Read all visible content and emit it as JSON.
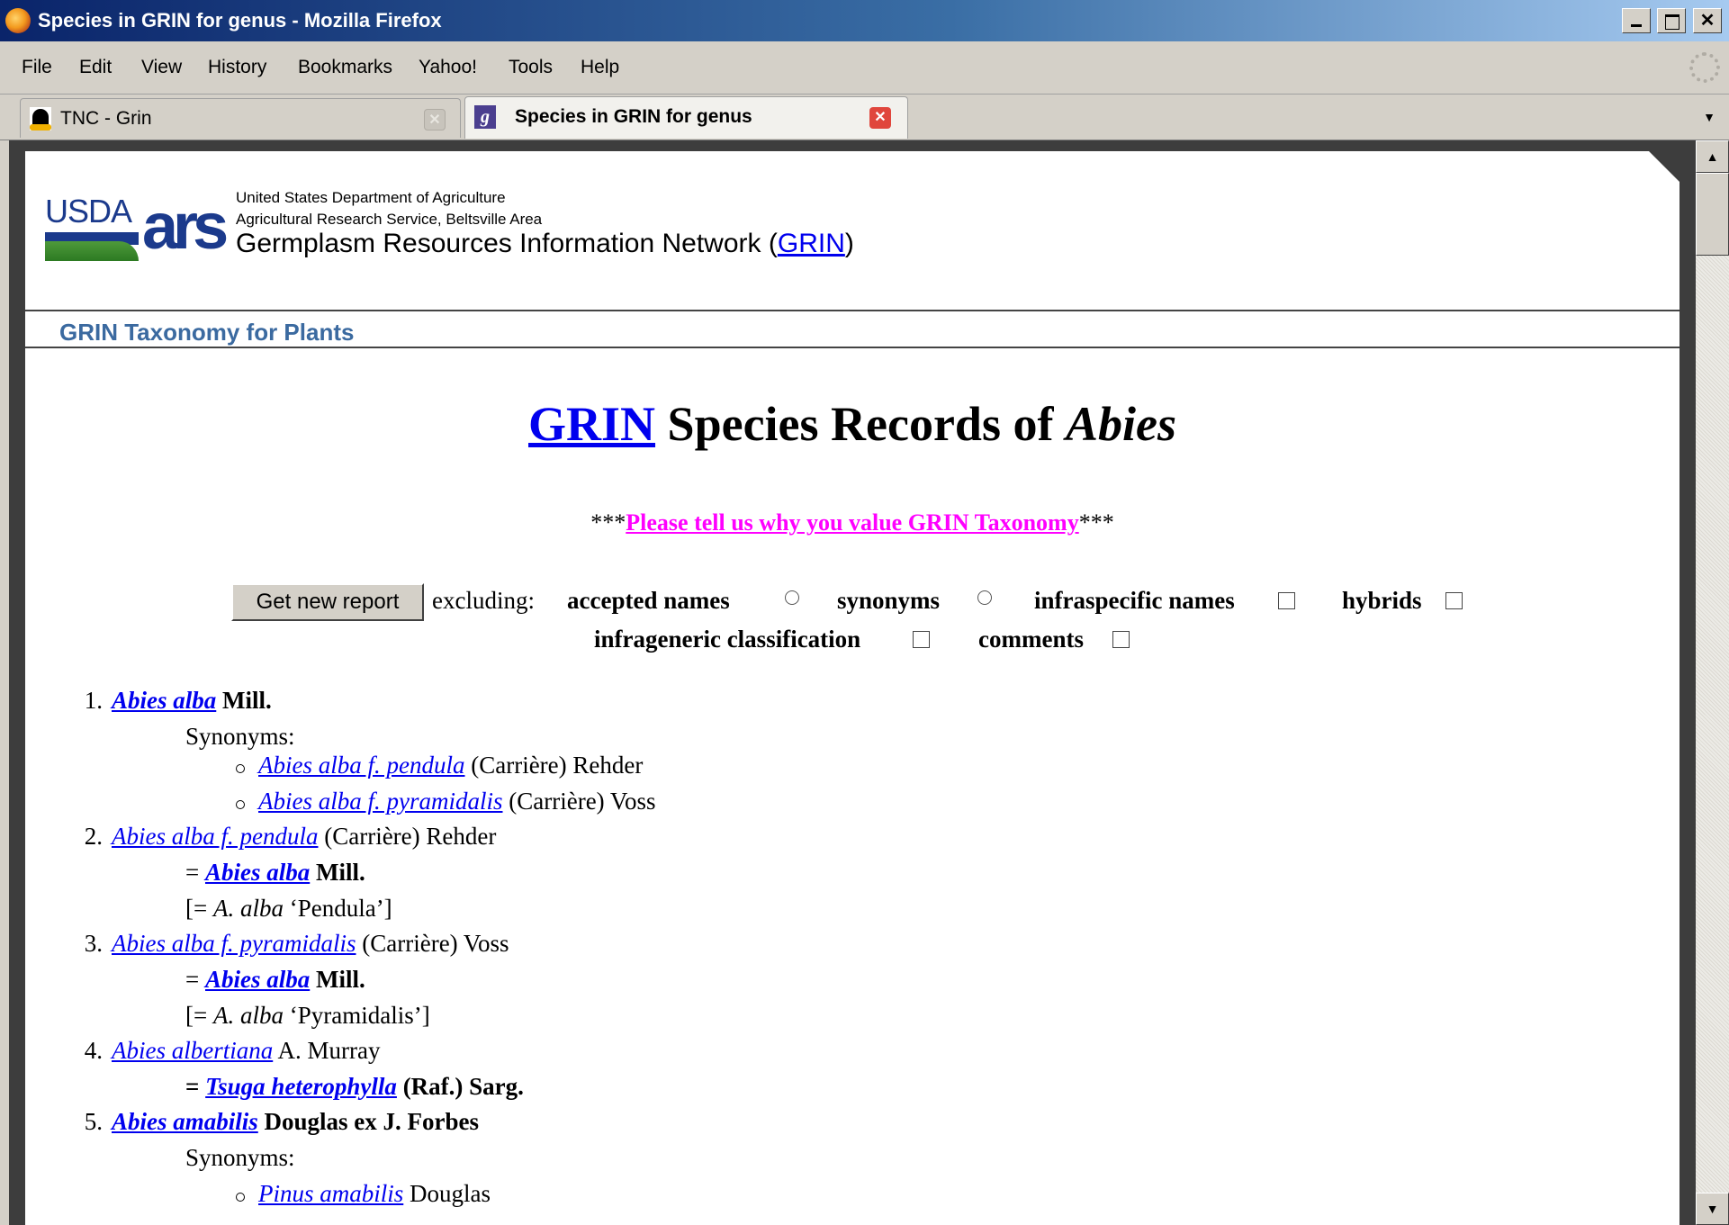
{
  "window": {
    "title": "Species in GRIN for genus - Mozilla Firefox"
  },
  "menubar": {
    "items": [
      "File",
      "Edit",
      "View",
      "History",
      "Bookmarks",
      "Yahoo!",
      "Tools",
      "Help"
    ]
  },
  "tabs": [
    {
      "label": "TNC - Grin",
      "favicon": "linux-penguin-icon",
      "active": false
    },
    {
      "label": "Species in GRIN for genus",
      "favicon": "grin-g-icon",
      "active": true
    }
  ],
  "header": {
    "logo_usda": "USDA",
    "logo_ars": "ars",
    "agency_line1": "United States Department of Agriculture",
    "agency_line2": "Agricultural Research Service, Beltsville Area",
    "network_prefix": "Germplasm Resources Information Network (",
    "network_link": "GRIN",
    "network_suffix": ")",
    "section_title": "GRIN Taxonomy for Plants"
  },
  "page": {
    "heading_link": "GRIN",
    "heading_text": " Species Records of ",
    "heading_genus": "Abies",
    "feedback_stars_left": "***",
    "feedback_link": "Please tell us why you value GRIN Taxonomy",
    "feedback_stars_right": "***",
    "report_button": "Get new report",
    "excluding_label": "excluding:",
    "options": {
      "accepted": "accepted names",
      "synonyms": "synonyms",
      "infraspecific": "infraspecific names",
      "hybrids": "hybrids",
      "infrageneric": "infrageneric classification",
      "comments": "comments"
    }
  },
  "records": {
    "r1": {
      "num": "1.",
      "name": "Abies alba",
      "author": " Mill.",
      "synonyms_label": "Synonyms:",
      "syn1": "Abies alba f. pendula",
      "syn1_author": " (Carrière) Rehder",
      "syn2": "Abies alba f. pyramidalis",
      "syn2_author": " (Carrière) Voss"
    },
    "r2": {
      "num": "2.",
      "name": "Abies alba f. pendula",
      "author": " (Carrière) Rehder",
      "eq": "= ",
      "eq_name": "Abies alba",
      "eq_author": " Mill.",
      "note_open": "[= ",
      "note_ital": "A. alba",
      "note_rest": " ‘Pendula’]"
    },
    "r3": {
      "num": "3.",
      "name": "Abies alba f. pyramidalis",
      "author": " (Carrière) Voss",
      "eq": "= ",
      "eq_name": "Abies alba",
      "eq_author": " Mill.",
      "note_open": "[= ",
      "note_ital": "A. alba",
      "note_rest": " ‘Pyramidalis’]"
    },
    "r4": {
      "num": "4.",
      "name": "Abies albertiana",
      "author": " A. Murray",
      "eq": "= ",
      "eq_name": "Tsuga heterophylla",
      "eq_author": " (Raf.) Sarg."
    },
    "r5": {
      "num": "5.",
      "name": "Abies amabilis",
      "author": " Douglas ex J. Forbes",
      "synonyms_label": "Synonyms:",
      "syn1": "Pinus amabilis",
      "syn1_author": " Douglas"
    }
  }
}
